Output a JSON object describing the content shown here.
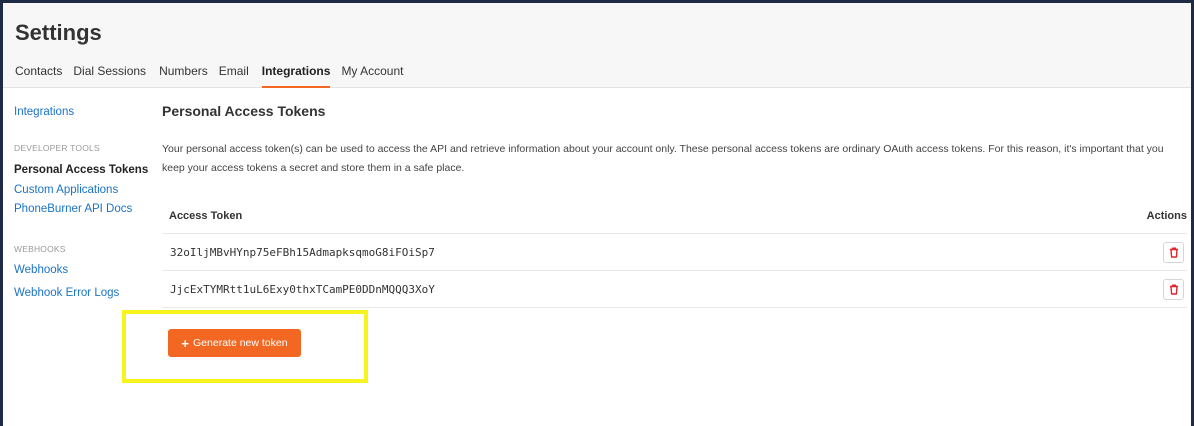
{
  "page": {
    "title": "Settings"
  },
  "tabs": [
    {
      "label": "Contacts"
    },
    {
      "label": "Dial Sessions"
    },
    {
      "label": "Numbers"
    },
    {
      "label": "Email"
    },
    {
      "label": "Integrations",
      "active": true
    },
    {
      "label": "My Account"
    }
  ],
  "sidebar": {
    "top_link": "Integrations",
    "developer_tools": {
      "heading": "DEVELOPER TOOLS",
      "items": [
        "Personal Access Tokens",
        "Custom Applications",
        "PhoneBurner API Docs"
      ]
    },
    "webhooks": {
      "heading": "WEBHOOKS",
      "items": [
        "Webhooks",
        "Webhook Error Logs"
      ]
    }
  },
  "main": {
    "title": "Personal Access Tokens",
    "description": "Your personal access token(s) can be used to access the API and retrieve information about your account only. These personal access tokens are ordinary OAuth access tokens. For this reason, it's important that you keep your access tokens a secret and store them in a safe place.",
    "table": {
      "headers": {
        "token": "Access Token",
        "actions": "Actions"
      },
      "rows": [
        {
          "token": "32oIljMBvHYnp75eFBh15AdmapksqmoG8iFOiSp7",
          "action_icon": "trash-icon"
        },
        {
          "token": "JjcExTYMRtt1uL6Exy0thxTCamPE0DDnMQQQ3XoY",
          "action_icon": "trash-icon"
        }
      ]
    },
    "generate_button": {
      "icon": "+",
      "label": "Generate new token"
    }
  },
  "colors": {
    "accent": "#f26722",
    "link": "#1a73c7",
    "delete_icon": "#e0252d",
    "highlight": "#f7f31d"
  }
}
